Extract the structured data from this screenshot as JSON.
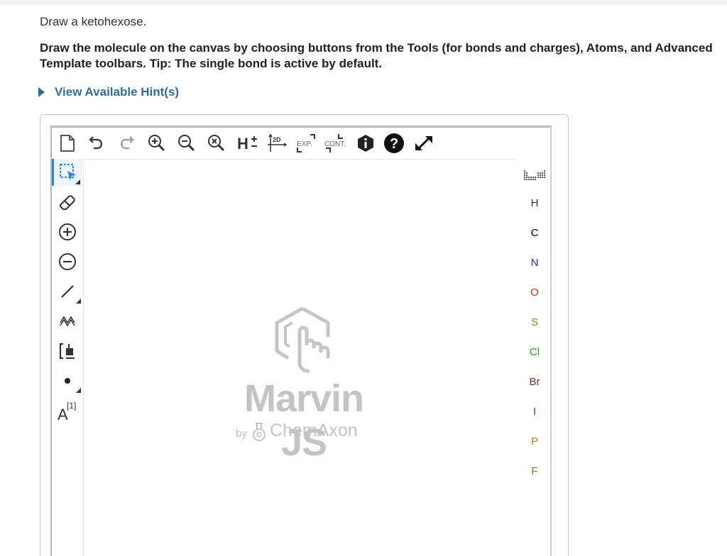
{
  "question": "Draw a ketohexose.",
  "instructions": "Draw the molecule on the canvas by choosing buttons from the Tools (for bonds and charges), Atoms, and Advanced Template toolbars. Tip: The single bond is active by default.",
  "hint_link": "View Available Hint(s)",
  "top_toolbar": {
    "items": [
      {
        "name": "new-document-icon"
      },
      {
        "name": "undo-icon"
      },
      {
        "name": "redo-icon"
      },
      {
        "name": "zoom-in-icon"
      },
      {
        "name": "zoom-out-icon"
      },
      {
        "name": "zoom-reset-icon"
      },
      {
        "name": "hydrogen-toggle-icon",
        "label": "H",
        "sup": "+"
      },
      {
        "name": "clean-2d-icon",
        "label": "2D"
      },
      {
        "name": "expand-group-icon",
        "label": "EXP."
      },
      {
        "name": "contract-group-icon",
        "label": "CONT."
      },
      {
        "name": "info-icon"
      },
      {
        "name": "help-icon"
      },
      {
        "name": "fullscreen-icon"
      }
    ]
  },
  "left_toolbar": {
    "items": [
      {
        "name": "select-tool-icon",
        "active": true
      },
      {
        "name": "eraser-icon"
      },
      {
        "name": "plus-charge-icon"
      },
      {
        "name": "minus-charge-icon"
      },
      {
        "name": "single-bond-icon"
      },
      {
        "name": "chain-icon"
      },
      {
        "name": "bracket-icon"
      },
      {
        "name": "electron-dot-icon"
      },
      {
        "name": "atom-mapping-icon",
        "label": "A",
        "sup": "[1]"
      }
    ]
  },
  "right_toolbar": {
    "periodic_table_icon": "periodic-table-icon",
    "atoms": [
      {
        "symbol": "H",
        "color": "#333333"
      },
      {
        "symbol": "C",
        "color": "#000000"
      },
      {
        "symbol": "N",
        "color": "#2233bb"
      },
      {
        "symbol": "O",
        "color": "#dd2222"
      },
      {
        "symbol": "S",
        "color": "#8a8a1a"
      },
      {
        "symbol": "Cl",
        "color": "#2a9a2a"
      },
      {
        "symbol": "Br",
        "color": "#7a2a20"
      },
      {
        "symbol": "I",
        "color": "#8a1aa0"
      },
      {
        "symbol": "P",
        "color": "#d07a00"
      },
      {
        "symbol": "F",
        "color": "#9a7a20"
      }
    ]
  },
  "watermark": {
    "title": "Marvin JS",
    "by": "by",
    "company": "ChemAxon"
  },
  "colors": {
    "link": "#2f6e94",
    "active_tool": "#2d7fe0",
    "watermark": "#c4c4c4"
  }
}
